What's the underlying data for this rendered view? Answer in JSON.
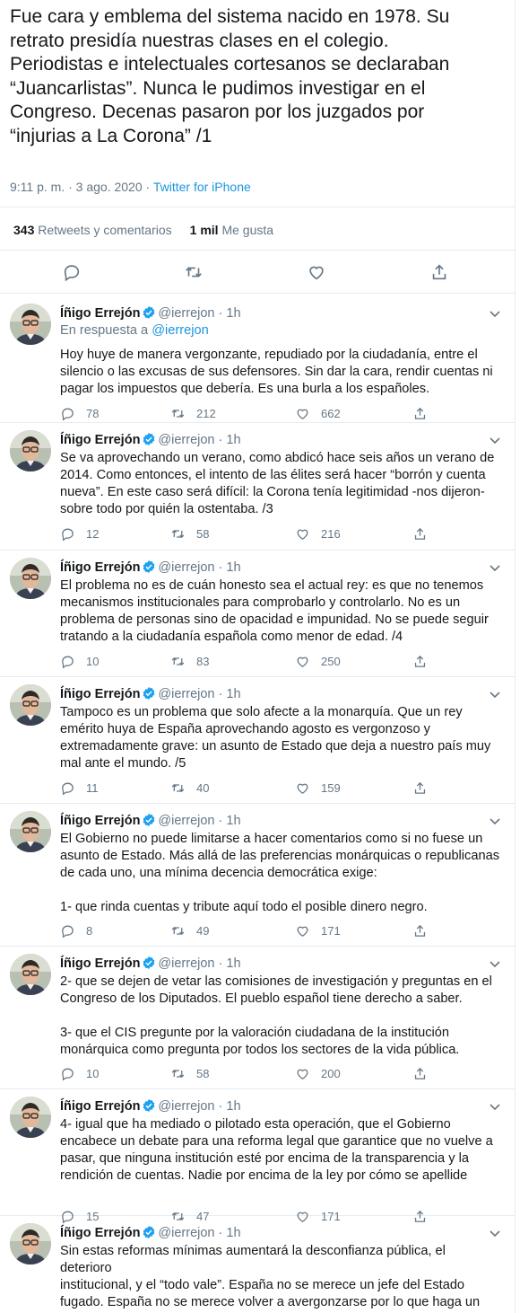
{
  "main": {
    "text": "Fue cara y emblema del sistema nacido en 1978. Su\nretrato presidía nuestras clases en el colegio.\nPeriodistas e intelectuales cortesanos se declaraban\n“Juancarlistas”. Nunca le pudimos investigar en el\nCongreso. Decenas pasaron por los juzgados por\n“injurias a La Corona” /1",
    "timestamp": "9:11 p. m. · 3 ago. 2020",
    "dot": " · ",
    "source": "Twitter for iPhone",
    "retweets_count": "343",
    "retweets_label": "Retweets y comentarios",
    "likes_count": "1 mil",
    "likes_label": "Me gusta"
  },
  "author": {
    "name": "Íñigo Errejón",
    "handle": "@ierrejon",
    "time": "1h",
    "sep": " · "
  },
  "replies": [
    {
      "in_reply_label": "En respuesta a ",
      "in_reply_handle": "@ierrejon",
      "text": "Hoy huye de manera vergonzante, repudiado por la ciudadanía, entre el\nsilencio o las excusas de sus defensores. Sin dar la cara, rendir cuentas ni\npagar los impuestos que debería. Es una burla a los españoles.",
      "replies": "78",
      "retweets": "212",
      "likes": "662"
    },
    {
      "text": "Se va aprovechando un verano, como abdicó hace seis años un verano de\n2014. Como entonces, el intento de las élites será hacer “borrón y cuenta\nnueva”. En este caso será difícil: la Corona tenía legitimidad -nos dijeron-\nsobre todo por quién la ostentaba. /3",
      "replies": "12",
      "retweets": "58",
      "likes": "216"
    },
    {
      "text": "El problema no es de cuán honesto sea el actual rey: es que no tenemos\nmecanismos institucionales para comprobarlo y controlarlo. No es un\nproblema de personas sino de opacidad e impunidad. No se puede seguir\ntratando a la ciudadanía española como menor de edad. /4",
      "replies": "10",
      "retweets": "83",
      "likes": "250"
    },
    {
      "text": "Tampoco es un problema que solo afecte a la monarquía. Que un rey\nemérito huya de España aprovechando agosto es vergonzoso y\nextremadamente grave: un asunto de Estado que deja a nuestro país muy\nmal ante el mundo. /5",
      "replies": "11",
      "retweets": "40",
      "likes": "159"
    },
    {
      "text": "El Gobierno no puede limitarse a hacer comentarios como si no fuese un\nasunto de Estado. Más allá de las preferencias monárquicas o republicanas\nde cada uno, una mínima decencia democrática exige:\n\n1- que rinda cuentas y tribute aquí todo el posible dinero negro.",
      "replies": "8",
      "retweets": "49",
      "likes": "171"
    },
    {
      "text": "2- que se dejen de vetar las comisiones de investigación y preguntas en el\nCongreso de los Diputados. El pueblo español tiene derecho a saber.\n\n3- que el CIS pregunte por la valoración ciudadana de la institución\nmonárquica como pregunta por todos los sectores de la vida pública.",
      "replies": "10",
      "retweets": "58",
      "likes": "200"
    },
    {
      "text": "4- igual que ha mediado o pilotado esta operación, que el Gobierno\nencabece un debate para una reforma legal que garantice que no vuelve a\npasar, que ninguna institución esté por encima de la transparencia y la\nrendición de cuentas. Nadie por encima de la ley por cómo se apellide",
      "replies": "15",
      "retweets": "47",
      "likes": "171"
    },
    {
      "text": "Sin estas reformas mínimas aumentará la desconfianza pública, el deterioro\ninstitucional, y el “todo vale”. España no se merece un jefe del Estado\nfugado. España no se merece volver a avergonzarse por lo que haga un rey.\nEspaña se merece poder decidir quién y cómo le representa."
    }
  ],
  "icons": [
    "reply-icon",
    "retweet-icon",
    "like-icon",
    "share-icon",
    "verified-badge-icon",
    "chevron-down-icon"
  ],
  "colors": {
    "link": "#1b95e0",
    "muted": "#657786",
    "text": "#14171a",
    "border": "#e6ecf0",
    "verified": "#1da1f2"
  }
}
